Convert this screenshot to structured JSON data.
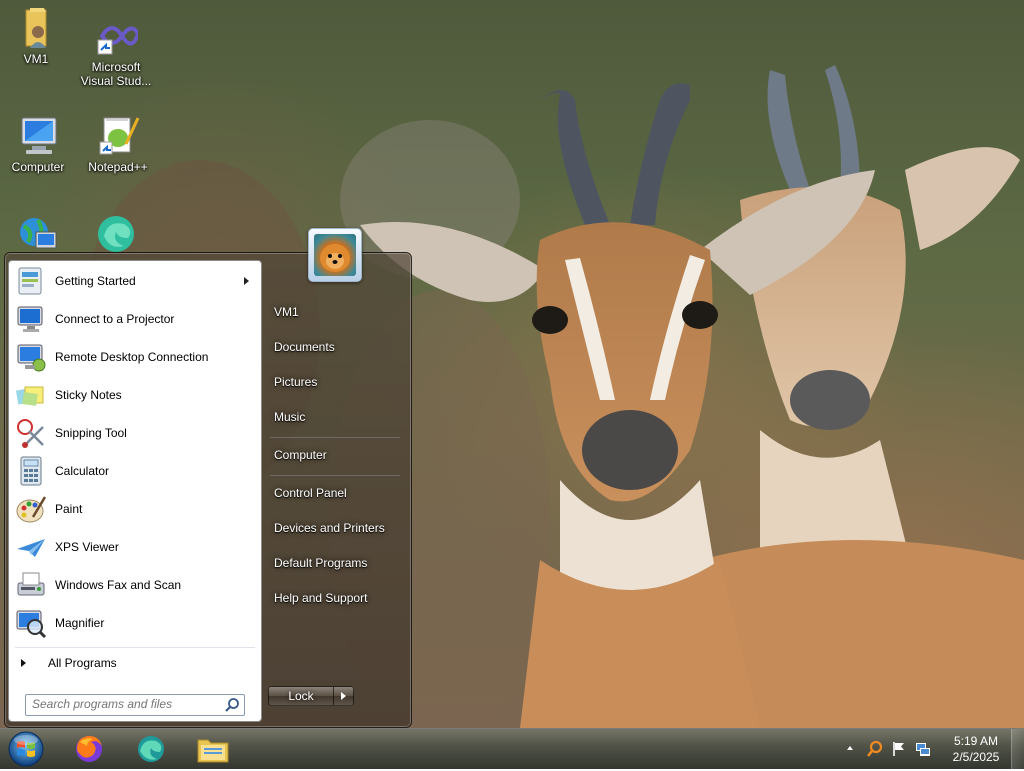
{
  "desktop": {
    "icons": [
      {
        "label": "VM1",
        "icon": "user-folder-icon"
      },
      {
        "label": "Microsoft Visual Stud...",
        "icon": "visual-studio-icon"
      },
      {
        "label": "Computer",
        "icon": "computer-icon"
      },
      {
        "label": "Notepad++",
        "icon": "notepad-plus-plus-icon"
      },
      {
        "label": "",
        "icon": "network-icon"
      },
      {
        "label": "",
        "icon": "edge-icon"
      }
    ]
  },
  "start_menu": {
    "programs": [
      {
        "label": "Getting Started",
        "icon": "getting-started-icon",
        "has_submenu": true
      },
      {
        "label": "Connect to a Projector",
        "icon": "projector-icon"
      },
      {
        "label": "Remote Desktop Connection",
        "icon": "remote-desktop-icon"
      },
      {
        "label": "Sticky Notes",
        "icon": "sticky-notes-icon"
      },
      {
        "label": "Snipping Tool",
        "icon": "snipping-tool-icon"
      },
      {
        "label": "Calculator",
        "icon": "calculator-icon"
      },
      {
        "label": "Paint",
        "icon": "paint-icon"
      },
      {
        "label": "XPS Viewer",
        "icon": "xps-viewer-icon"
      },
      {
        "label": "Windows Fax and Scan",
        "icon": "fax-scan-icon"
      },
      {
        "label": "Magnifier",
        "icon": "magnifier-icon"
      }
    ],
    "all_programs": "All Programs",
    "search_placeholder": "Search programs and files",
    "right_items": [
      "VM1",
      "Documents",
      "Pictures",
      "Music",
      "Computer",
      "Control Panel",
      "Devices and Printers",
      "Default Programs",
      "Help and Support"
    ],
    "lock_label": "Lock"
  },
  "taskbar": {
    "pinned": [
      "firefox-icon",
      "edge-icon",
      "file-explorer-icon"
    ],
    "tray_icons": [
      "show-hidden-icons-arrow",
      "search-tray-icon",
      "action-center-flag-icon",
      "network-tray-icon"
    ],
    "time": "5:19 AM",
    "date": "2/5/2025"
  }
}
